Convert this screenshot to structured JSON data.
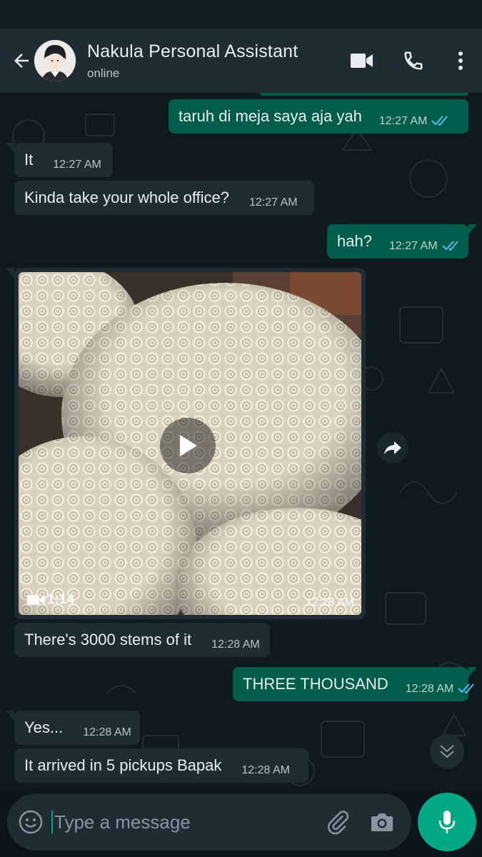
{
  "header": {
    "contact_name": "Nakula Personal Assistant",
    "status": "online",
    "icons": [
      "back-arrow-icon",
      "video-call-icon",
      "voice-call-icon",
      "more-options-icon"
    ]
  },
  "messages": [
    {
      "direction": "out",
      "text": "taruh di meja saya aja yah",
      "time": "12:27 AM",
      "read": true
    },
    {
      "direction": "in",
      "text": "It",
      "time": "12:27 AM"
    },
    {
      "direction": "in",
      "text": "Kinda take your whole office?",
      "time": "12:27 AM"
    },
    {
      "direction": "out",
      "text": "hah?",
      "time": "12:27 AM",
      "read": true
    },
    {
      "direction": "in",
      "type": "video",
      "duration": "1:14",
      "time": "12:28 AM"
    },
    {
      "direction": "in",
      "text": "There's 3000 stems of it",
      "time": "12:28 AM"
    },
    {
      "direction": "out",
      "text": "THREE THOUSAND",
      "time": "12:28 AM",
      "read": true
    },
    {
      "direction": "in",
      "text": "Yes...",
      "time": "12:28 AM"
    },
    {
      "direction": "in",
      "text": "It arrived in 5 pickups Bapak",
      "time": "12:28 AM"
    }
  ],
  "composer": {
    "placeholder": "Type a message",
    "value": "",
    "icons": [
      "emoji-icon",
      "attach-icon",
      "camera-icon",
      "mic-icon"
    ]
  },
  "colors": {
    "header_bg": "#1f2c33",
    "incoming_bubble": "#1f2c33",
    "outgoing_bubble": "#005c4b",
    "read_ticks": "#53bdeb",
    "accent": "#00a884"
  }
}
